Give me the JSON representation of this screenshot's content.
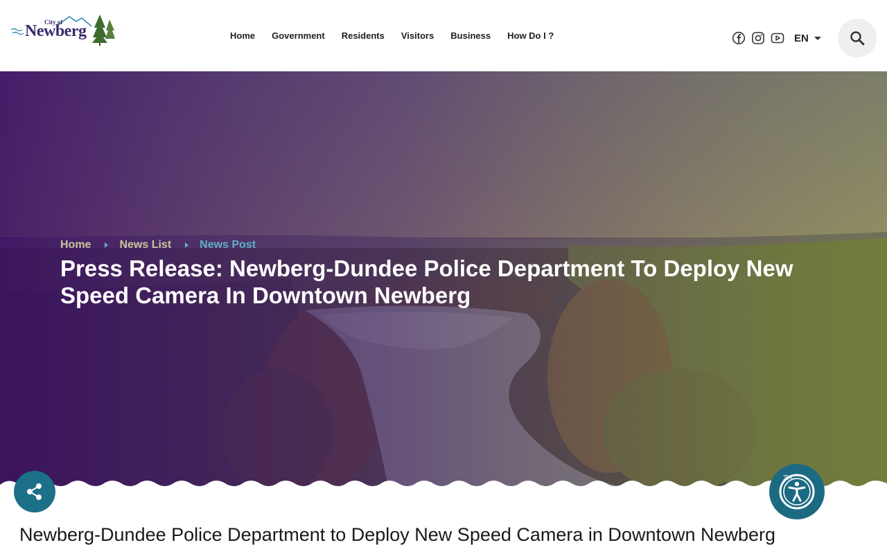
{
  "header": {
    "logo": {
      "city_text": "City of",
      "name_text": "Newberg"
    },
    "nav": [
      {
        "label": "Home"
      },
      {
        "label": "Government"
      },
      {
        "label": "Residents"
      },
      {
        "label": "Visitors"
      },
      {
        "label": "Business"
      },
      {
        "label": "How Do I ?"
      }
    ],
    "social_icons": [
      "facebook-icon",
      "instagram-icon",
      "youtube-icon"
    ],
    "language": "EN",
    "search_icon": "search-icon"
  },
  "hero": {
    "breadcrumb": [
      {
        "label": "Home"
      },
      {
        "label": "News List"
      },
      {
        "label": "News Post"
      }
    ],
    "title": "Press Release: Newberg-Dundee Police Department To Deploy New Speed Camera In Downtown Newberg"
  },
  "article": {
    "heading": "Newberg-Dundee Police Department to Deploy New Speed Camera in Downtown Newberg"
  },
  "floating": {
    "share_icon": "share-icon",
    "accessibility_icon": "accessibility-icon"
  },
  "colors": {
    "brand_purple": "#3b2a6e",
    "accent_teal": "#1c7088",
    "breadcrumb_current": "#5fb0c6",
    "breadcrumb_link": "#c9c59a"
  }
}
